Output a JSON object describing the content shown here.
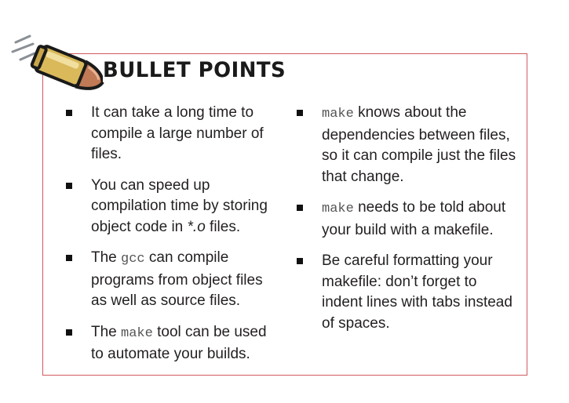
{
  "colors": {
    "border": "#d0595f",
    "text": "#231f20",
    "code": "#555555"
  },
  "icon": "bullet-cartridge-icon",
  "title": "BULLET POINTS",
  "left_column": [
    {
      "text": "It can take a long time to compile a large number of files."
    },
    {
      "text_before": "You can speed up compilation time by storing object code in ",
      "italic": "*.o",
      "text_after": " files."
    },
    {
      "text_before": "The ",
      "code": "gcc",
      "text_after": " can compile programs from object files as well as source files."
    },
    {
      "text_before": "The ",
      "code": "make",
      "text_after": " tool can be used to automate your builds."
    }
  ],
  "right_column": [
    {
      "code": "make",
      "text_after": " knows about the dependencies between files, so it can compile just the files that change."
    },
    {
      "code": "make",
      "text_after": " needs to be told about your build with a makefile."
    },
    {
      "text": "Be careful formatting your makefile: don’t forget to indent lines with tabs instead of spaces."
    }
  ]
}
